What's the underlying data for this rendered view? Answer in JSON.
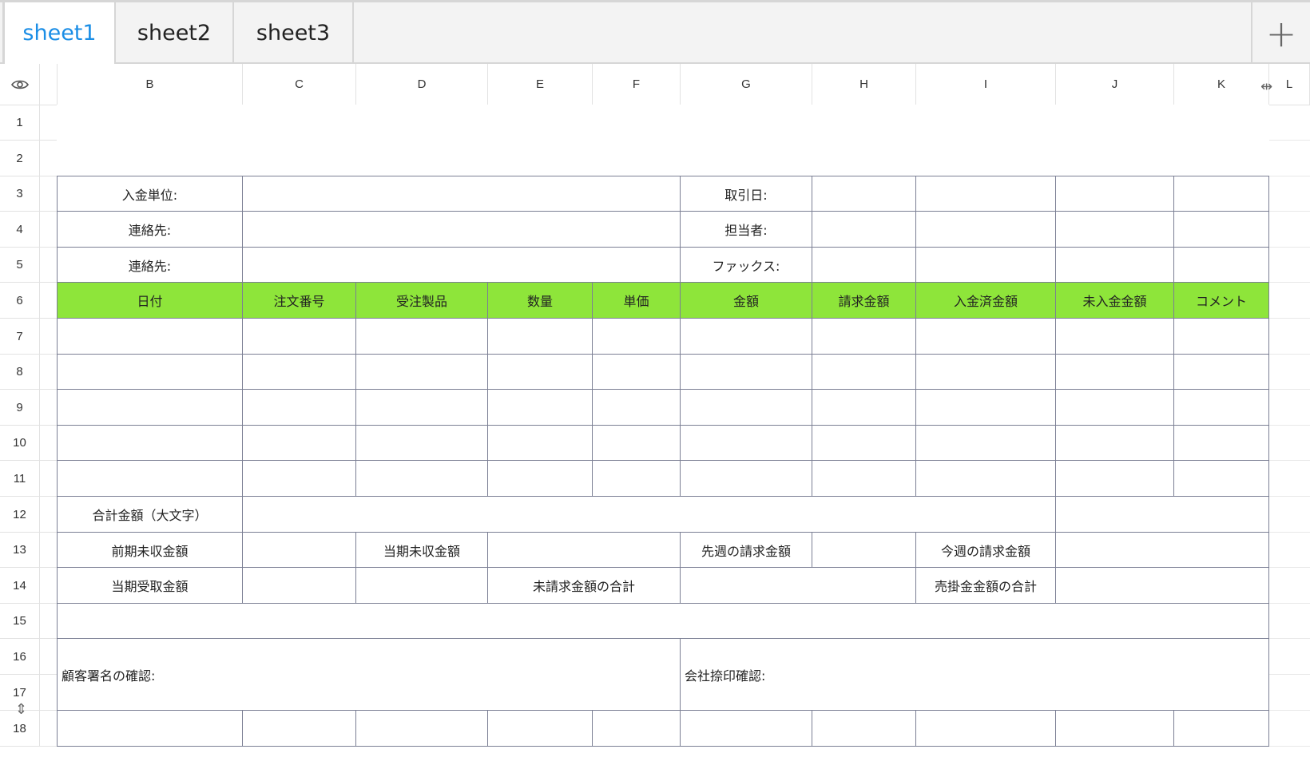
{
  "tabs": [
    "sheet1",
    "sheet2",
    "sheet3"
  ],
  "add_tab_label": "+",
  "columns": [
    "B",
    "C",
    "D",
    "E",
    "F",
    "G",
    "H",
    "I",
    "J",
    "K",
    "L"
  ],
  "rows": [
    "1",
    "2",
    "3",
    "4",
    "5",
    "6",
    "7",
    "8",
    "9",
    "10",
    "11",
    "12",
    "13",
    "14",
    "15",
    "16",
    "17",
    "18"
  ],
  "form": {
    "payment_unit": "入金単位:",
    "contact1": "連絡先:",
    "contact2": "連絡先:",
    "transaction_date": "取引日:",
    "person_in_charge": "担当者:",
    "fax": "ファックス:",
    "headers": [
      "日付",
      "注文番号",
      "受注製品",
      "数量",
      "単価",
      "金額",
      "請求金額",
      "入金済金額",
      "未入金金額",
      "コメント"
    ],
    "total_amount_kanji": "合計金額（大文字）",
    "prev_receivable": "前期未収金額",
    "current_receivable": "当期未収金額",
    "last_week_billing": "先週の請求金額",
    "this_week_billing": "今週の請求金額",
    "current_received": "当期受取金額",
    "unbilled_total": "未請求金額の合計",
    "receivable_total": "売掛金金額の合計",
    "customer_signature": "顧客署名の確認:",
    "company_seal": "会社捺印確認:"
  },
  "colors": {
    "header_fill": "#8ee53a",
    "active_tab": "#1b8ee6"
  }
}
